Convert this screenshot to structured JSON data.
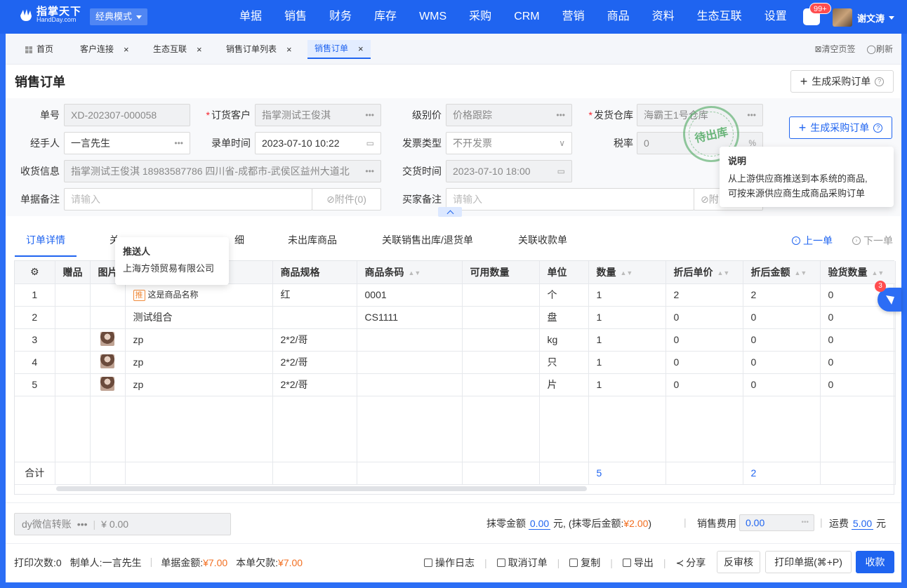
{
  "app": {
    "logo_cn": "指掌天下",
    "logo_en": "HandDay.com",
    "mode": "经典模式",
    "user": "谢文涛",
    "notif_count": "99+"
  },
  "nav": [
    "单据",
    "销售",
    "财务",
    "库存",
    "WMS",
    "采购",
    "CRM",
    "营销",
    "商品",
    "资料",
    "生态互联",
    "设置"
  ],
  "tabs": {
    "home": "首页",
    "items": [
      "客户连接",
      "生态互联",
      "销售订单列表",
      "销售订单"
    ],
    "clear": "清空页签",
    "refresh": "刷新"
  },
  "page": {
    "title": "销售订单",
    "gen_purchase": "生成采购订单"
  },
  "form": {
    "order_no_label": "单号",
    "order_no": "XD-202307-000058",
    "customer_label": "订货客户",
    "customer": "指掌测试王俊淇",
    "price_level_label": "级别价",
    "price_level": "价格跟踪",
    "warehouse_label": "发货仓库",
    "warehouse": "海霸王1号仓库",
    "handler_label": "经手人",
    "handler": "一言先生",
    "entry_time_label": "录单时间",
    "entry_time": "2023-07-10 10:22",
    "invoice_label": "发票类型",
    "invoice": "不开发票",
    "tax_label": "税率",
    "tax": "0",
    "tax_unit": "%",
    "address_label": "收货信息",
    "address": "指掌测试王俊淇 18983587786 四川省-成都市-武侯区益州大道北",
    "delivery_label": "交货时间",
    "delivery": "2023-07-10 18:00",
    "remark_label": "单据备注",
    "remark_ph": "请输入",
    "attach": "附件(0)",
    "buyer_remark_label": "买家备注",
    "buyer_remark_ph": "请输入",
    "attach2": "附"
  },
  "stamp": "待出库",
  "note_tip": {
    "title": "说明",
    "line1": "从上游供应商推送到本系统的商品,",
    "line2": "可按来源供应商生成商品采购订单"
  },
  "push_tip": {
    "title": "推送人",
    "value": "上海方领贸易有限公司"
  },
  "subtabs": {
    "active": "订单详情",
    "t2": "关",
    "t3": "细",
    "t4": "未出库商品",
    "t5": "关联销售出库/退货单",
    "t6": "关联收款单",
    "prev": "上一单",
    "next": "下一单"
  },
  "table": {
    "headers": {
      "gift": "赠品",
      "img": "图片",
      "spec": "商品规格",
      "barcode": "商品条码",
      "avail": "可用数量",
      "unit": "单位",
      "qty": "数量",
      "price": "折后单价",
      "amount": "折后金额",
      "check": "验货数量"
    },
    "push_badge": "推",
    "rows": [
      {
        "no": "1",
        "name": "这是商品名称",
        "spec": "红",
        "barcode": "0001",
        "unit": "个",
        "qty": "1",
        "price": "2",
        "amount": "2",
        "check": "0"
      },
      {
        "no": "2",
        "name": "测试组合",
        "spec": "",
        "barcode": "CS1111",
        "unit": "盘",
        "qty": "1",
        "price": "0",
        "amount": "0",
        "check": "0"
      },
      {
        "no": "3",
        "name": "zp",
        "spec": "2*2/哥",
        "barcode": "",
        "unit": "kg",
        "qty": "1",
        "price": "0",
        "amount": "0",
        "check": "0"
      },
      {
        "no": "4",
        "name": "zp",
        "spec": "2*2/哥",
        "barcode": "",
        "unit": "只",
        "qty": "1",
        "price": "0",
        "amount": "0",
        "check": "0"
      },
      {
        "no": "5",
        "name": "zp",
        "spec": "2*2/哥",
        "barcode": "",
        "unit": "片",
        "qty": "1",
        "price": "0",
        "amount": "0",
        "check": "0"
      }
    ],
    "total_label": "合计",
    "total_qty": "5",
    "total_amount": "2"
  },
  "float_badge": "3",
  "payment": {
    "account": "dy微信转账",
    "amount": "¥ 0.00"
  },
  "fees": {
    "round_label": "抹零金额",
    "round": "0.00",
    "yuan": "元,",
    "after_label": "(抹零后金额:",
    "after": "¥2.00",
    "after_close": ")",
    "sales_fee_label": "销售费用",
    "sales_fee": "0.00",
    "freight_label": "运费",
    "freight": "5.00",
    "freight_unit": "元"
  },
  "footer": {
    "print_count": "打印次数:0",
    "creator": "制单人:一言先生",
    "amount_label": "单据金额:",
    "amount": "¥7.00",
    "debt_label": "本单欠款:",
    "debt": "¥7.00",
    "log": "操作日志",
    "cancel": "取消订单",
    "copy": "复制",
    "export": "导出",
    "share": "分享",
    "unaudit": "反审核",
    "print": "打印单据(⌘+P)",
    "collect": "收款"
  }
}
